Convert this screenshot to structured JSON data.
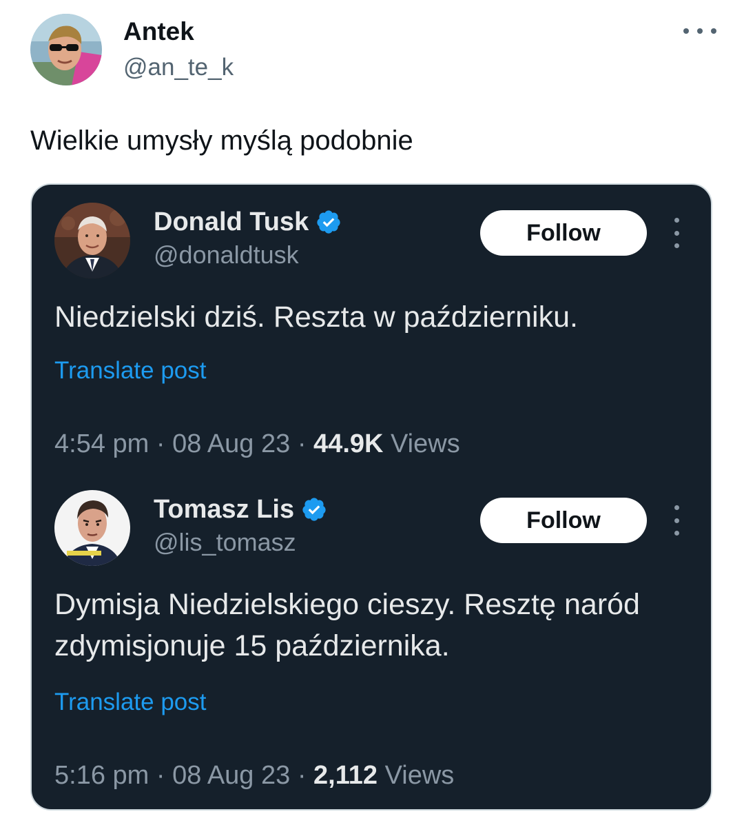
{
  "post": {
    "author_name": "Antek",
    "author_handle": "@an_te_k",
    "more_icon": "more-horizontal-icon",
    "text": "Wielkie umysły myślą podobnie"
  },
  "embedded": {
    "tweets": [
      {
        "name": "Donald Tusk",
        "handle": "@donaldtusk",
        "verified": true,
        "follow_label": "Follow",
        "text": "Niedzielski dziś. Reszta w październiku.",
        "translate_label": "Translate post",
        "time": "4:54 pm",
        "date": "08 Aug 23",
        "views_count": "44.9K",
        "views_label": "Views",
        "separator": "·"
      },
      {
        "name": "Tomasz Lis",
        "handle": "@lis_tomasz",
        "verified": true,
        "follow_label": "Follow",
        "text": "Dymisja Niedzielskiego cieszy. Resztę naród zdymisjonuje 15 października.",
        "translate_label": "Translate post",
        "time": "5:16 pm",
        "date": "08 Aug 23",
        "views_count": "2,112",
        "views_label": "Views",
        "separator": "·"
      }
    ]
  },
  "colors": {
    "card_background": "#15202b",
    "link": "#1d9bf0",
    "verified": "#1d9bf0",
    "secondary_text": "#8b98a5"
  }
}
